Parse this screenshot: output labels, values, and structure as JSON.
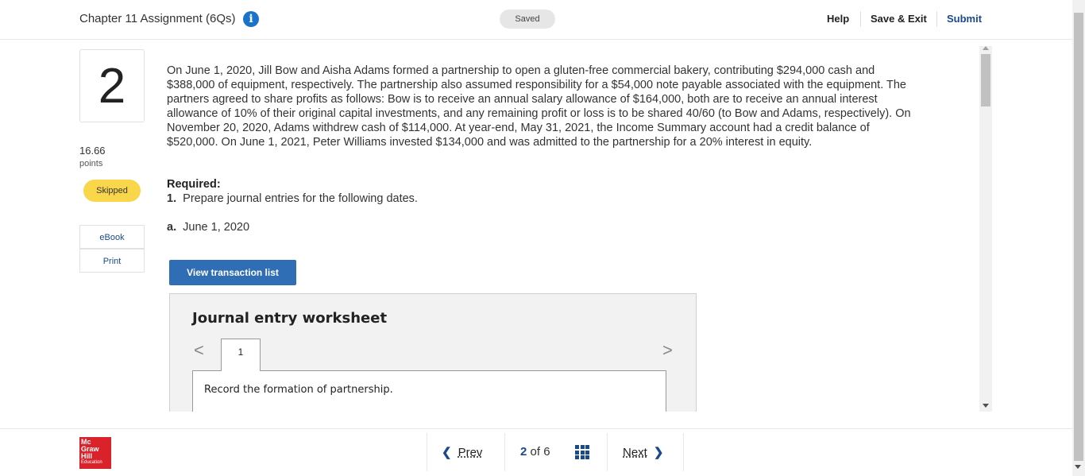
{
  "header": {
    "assignment_title": "Chapter 11 Assignment (6Qs)",
    "info_glyph": "i",
    "saved_status": "Saved",
    "help_label": "Help",
    "save_exit_label": "Save & Exit",
    "submit_label": "Submit"
  },
  "question": {
    "number": "2",
    "points_value": "16.66",
    "points_label": "points",
    "status": "Skipped",
    "side_links": [
      "eBook",
      "Print"
    ],
    "text": "On June 1, 2020, Jill Bow and Aisha Adams formed a partnership to open a gluten-free commercial bakery, contributing $294,000 cash and $388,000 of equipment, respectively. The partnership also assumed responsibility for a $54,000 note payable associated with the equipment. The partners agreed to share profits as follows: Bow is to receive an annual salary allowance of $164,000, both are to receive an annual interest allowance of 10% of their original capital investments, and any remaining profit or loss is to be shared 40/60 (to Bow and Adams, respectively). On November 20, 2020, Adams withdrew cash of $114,000. At year-end, May 31, 2021, the Income Summary account had a credit balance of $520,000. On June 1, 2021, Peter Williams invested $134,000 and was admitted to the partnership for a 20% interest in equity.",
    "required_title": "Required:",
    "required_num": "1.",
    "required_text": "Prepare journal entries for the following dates.",
    "part_label": "a.",
    "part_text": "June 1, 2020",
    "view_button": "View transaction list"
  },
  "worksheet": {
    "title": "Journal entry worksheet",
    "prev_glyph": "<",
    "next_glyph": ">",
    "tab": "1",
    "instruction": "Record the formation of partnership."
  },
  "footer": {
    "logo_lines": [
      "Mc",
      "Graw",
      "Hill"
    ],
    "logo_sub": "Education",
    "prev_label": "Prev",
    "current_page": "2",
    "of_label": "of",
    "total_pages": "6",
    "next_label": "Next"
  },
  "colors": {
    "accent_blue": "#1a4a8a",
    "button_blue": "#2f6db5",
    "skipped_yellow": "#fad64a",
    "logo_red": "#d9222a"
  }
}
